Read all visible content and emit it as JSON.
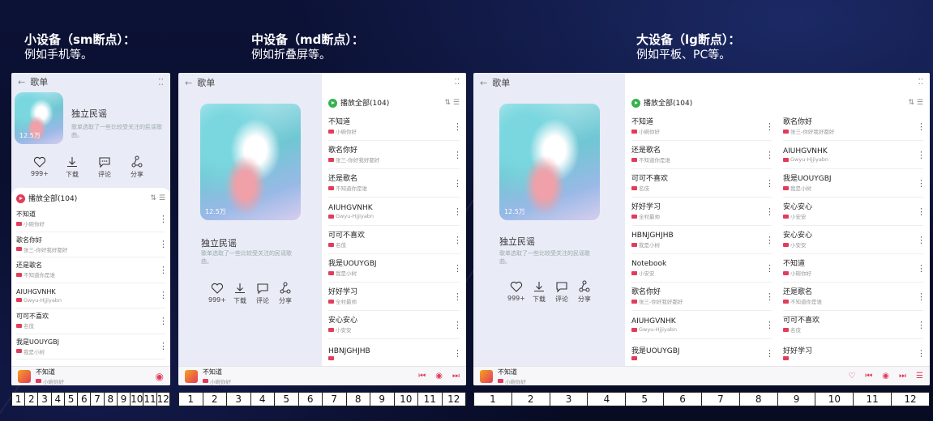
{
  "sections": [
    {
      "title": "小设备（sm断点）：",
      "sub": "例如手机等。"
    },
    {
      "title": "中设备（md断点）：",
      "sub": "例如折叠屏等。"
    },
    {
      "title": "大设备（lg断点）：",
      "sub": "例如平板、PC等。"
    }
  ],
  "app": {
    "page_title": "歌单",
    "playlist_title": "独立民谣",
    "description": "歌单选取了一些比较受关注的民谣歌曲。",
    "play_count": "12.5万",
    "play_all": "播放全部(104)",
    "actions": [
      {
        "label": "999+",
        "icon": "heart-icon"
      },
      {
        "label": "下载",
        "icon": "download-icon"
      },
      {
        "label": "评论",
        "icon": "comment-icon"
      },
      {
        "label": "分享",
        "icon": "share-icon"
      }
    ],
    "accent_color": "#e23c5a",
    "play_all_color_sm": "#e23c5a",
    "play_all_color_md": "#37b24d"
  },
  "songs_sm": [
    {
      "name": "不知道",
      "artist": "小碗你好"
    },
    {
      "name": "歌名你好",
      "artist": "张三-你好我好都好"
    },
    {
      "name": "还是歌名",
      "artist": "不知道你是谁"
    },
    {
      "name": "AIUHGVNHK",
      "artist": "Gwyu-Hjjiyabn"
    },
    {
      "name": "可可不喜欢",
      "artist": "名伎"
    },
    {
      "name": "我是UOUYGBJ",
      "artist": "我是小树"
    }
  ],
  "songs_md": [
    {
      "name": "不知道",
      "artist": "小碗你好"
    },
    {
      "name": "歌名你好",
      "artist": "张三-你好我好都好"
    },
    {
      "name": "还是歌名",
      "artist": "不知道你是谁"
    },
    {
      "name": "AIUHGVNHK",
      "artist": "Gwyu-Hjjiyabn"
    },
    {
      "name": "可可不喜欢",
      "artist": "名伎"
    },
    {
      "name": "我是UOUYGBJ",
      "artist": "我是小树"
    },
    {
      "name": "好好学习",
      "artist": "全村最帅"
    },
    {
      "name": "安心安心",
      "artist": "小安安"
    },
    {
      "name": "HBNJGHJHB",
      "artist": ""
    }
  ],
  "songs_lg_left": [
    {
      "name": "不知道",
      "artist": "小碗你好"
    },
    {
      "name": "还是歌名",
      "artist": "不知道你是谁"
    },
    {
      "name": "可可不喜欢",
      "artist": "名伎"
    },
    {
      "name": "好好学习",
      "artist": "全村最帅"
    },
    {
      "name": "HBNJGHJHB",
      "artist": "我是小树"
    },
    {
      "name": "Notebook",
      "artist": "小安安"
    },
    {
      "name": "歌名你好",
      "artist": "张三-你好我好都好"
    },
    {
      "name": "AIUHGVNHK",
      "artist": "Gwyu-Hjjiyabn"
    },
    {
      "name": "我是UOUYGBJ",
      "artist": ""
    }
  ],
  "songs_lg_right": [
    {
      "name": "歌名你好",
      "artist": "张三-你好我好都好"
    },
    {
      "name": "AIUHGVNHK",
      "artist": "Gwyu-Hjjiyabn"
    },
    {
      "name": "我是UOUYGBJ",
      "artist": "我是小树"
    },
    {
      "name": "安心安心",
      "artist": "小安安"
    },
    {
      "name": "安心安心",
      "artist": "小安安"
    },
    {
      "name": "不知道",
      "artist": "小碗你好"
    },
    {
      "name": "还是歌名",
      "artist": "不知道你是谁"
    },
    {
      "name": "可可不喜欢",
      "artist": "名伎"
    },
    {
      "name": "好好学习",
      "artist": ""
    }
  ],
  "now_playing": {
    "name": "不知道",
    "artist": "小碗你好"
  },
  "grids": {
    "sm": [
      "1",
      "2",
      "3",
      "4",
      "5",
      "6",
      "7",
      "8",
      "9",
      "10",
      "11",
      "12"
    ],
    "md": [
      "1",
      "2",
      "3",
      "4",
      "5",
      "6",
      "7",
      "8",
      "9",
      "10",
      "11",
      "12"
    ],
    "lg": [
      "1",
      "2",
      "3",
      "4",
      "5",
      "6",
      "7",
      "8",
      "9",
      "10",
      "11",
      "12"
    ]
  }
}
